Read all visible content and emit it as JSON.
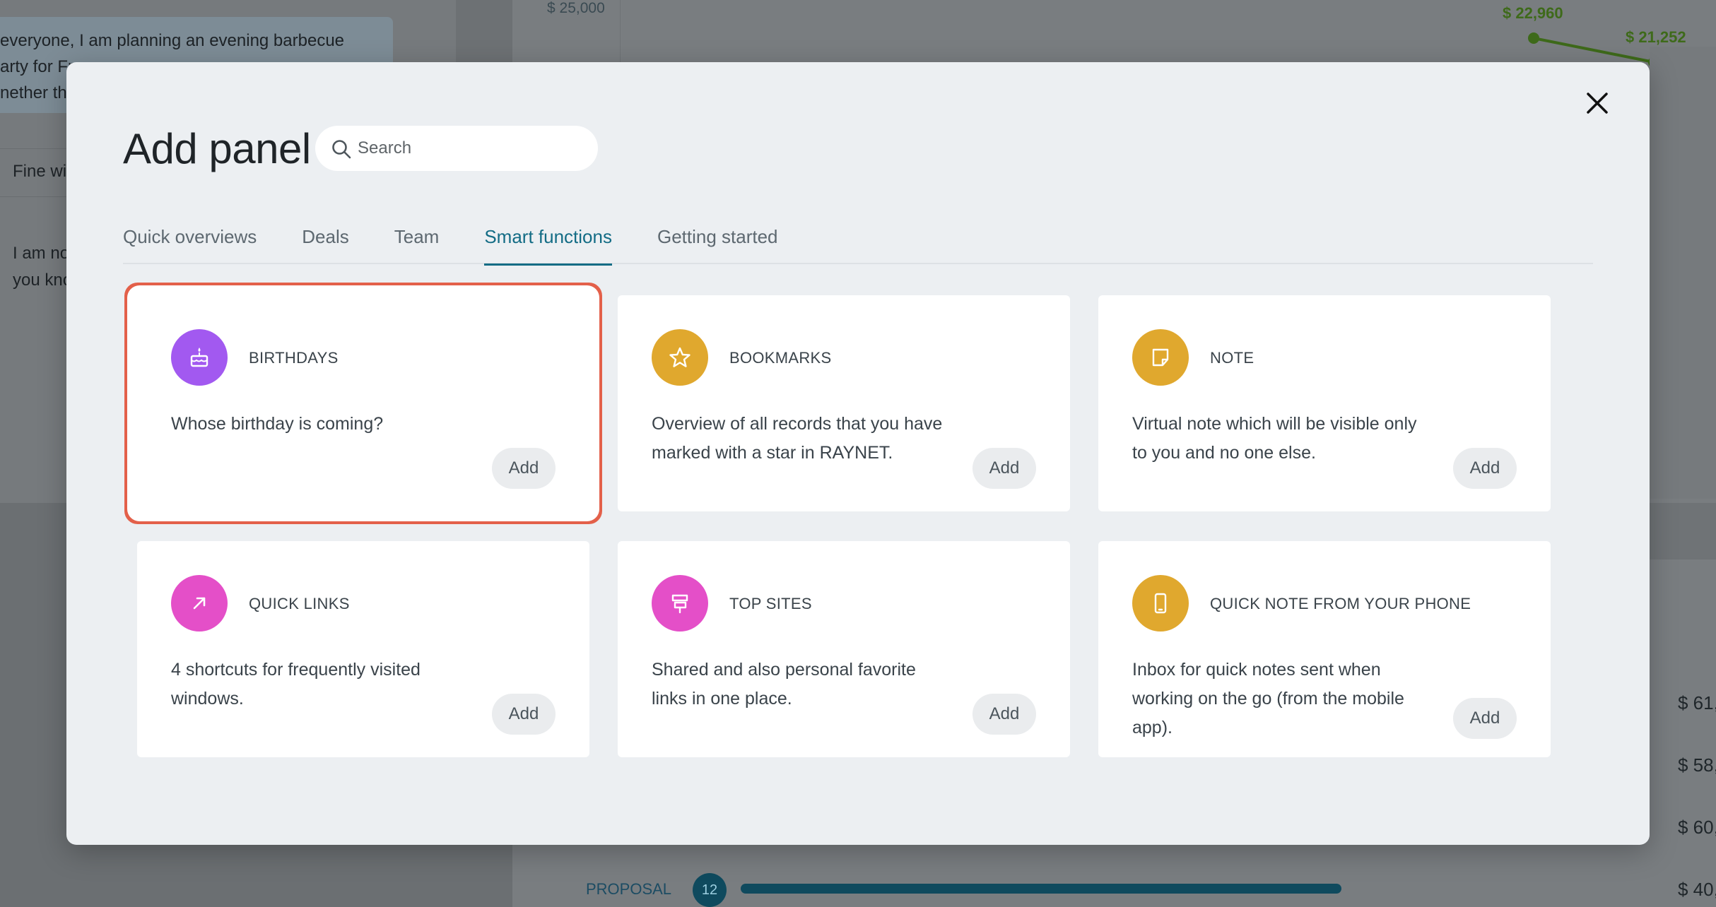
{
  "background": {
    "chat": {
      "line1": "everyone, I am planning an evening barbecue",
      "line2": "arty for Fr",
      "line3": "nether the",
      "line4": "Fine wi",
      "line5": "I am no",
      "line6": "you kno"
    },
    "chart": {
      "y_tick": "$ 25,000",
      "price1": "$ 22,960",
      "price2": "$ 21,252"
    },
    "values": [
      "$ 61,",
      "$ 58,",
      "$ 60,",
      "$ 40,"
    ],
    "pipeline": {
      "label": "PROPOSAL",
      "count": "12"
    }
  },
  "modal": {
    "title": "Add panel",
    "search": {
      "placeholder": "Search",
      "value": ""
    },
    "tabs": [
      {
        "label": "Quick overviews",
        "active": false
      },
      {
        "label": "Deals",
        "active": false
      },
      {
        "label": "Team",
        "active": false
      },
      {
        "label": "Smart functions",
        "active": true
      },
      {
        "label": "Getting started",
        "active": false
      }
    ],
    "cards": [
      {
        "title": "BIRTHDAYS",
        "description": "Whose birthday is coming?",
        "button": "Add",
        "icon": "cake-icon",
        "color": "#a259f0",
        "selected": true
      },
      {
        "title": "BOOKMARKS",
        "description": "Overview of all records that you have marked with a star in RAYNET.",
        "button": "Add",
        "icon": "star-icon",
        "color": "#e0a82e"
      },
      {
        "title": "NOTE",
        "description": "Virtual note which will be visible only to you and no one else.",
        "button": "Add",
        "icon": "note-icon",
        "color": "#e0a82e"
      },
      {
        "title": "QUICK LINKS",
        "description": "4 shortcuts for frequently visited windows.",
        "button": "Add",
        "icon": "arrow-up-right-icon",
        "color": "#e44fc8"
      },
      {
        "title": "TOP SITES",
        "description": "Shared and also personal favorite links in one place.",
        "button": "Add",
        "icon": "signpost-icon",
        "color": "#e44fc8"
      },
      {
        "title": "QUICK NOTE FROM YOUR PHONE",
        "description": "Inbox for quick notes sent when working on the go (from the mobile app).",
        "button": "Add",
        "icon": "phone-icon",
        "color": "#e0a82e"
      }
    ]
  },
  "colors": {
    "accent": "#136c85",
    "selection_border": "#e3604a"
  }
}
